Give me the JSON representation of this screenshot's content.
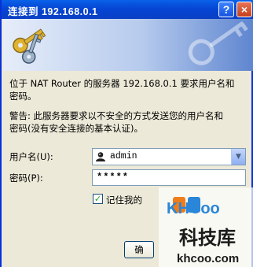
{
  "window": {
    "title": "连接到 192.168.0.1",
    "help_label": "?",
    "close_label": "×"
  },
  "message": {
    "line1": "位于 NAT Router 的服务器 192.168.0.1 要求用户名和",
    "line2": "密码。",
    "warning1": "警告: 此服务器要求以不安全的方式发送您的用户名和",
    "warning2": "密码(没有安全连接的基本认证)。"
  },
  "form": {
    "username_label": "用户名(U):",
    "username_value": "admin",
    "password_label": "密码(P):",
    "password_value": "*****",
    "remember_label": "记住我的",
    "remember_checked": "✓"
  },
  "buttons": {
    "ok_label": "确"
  },
  "watermark": {
    "logo_text": "KHCoo",
    "cn_text": "科技库",
    "url_text": "khcoo.com"
  },
  "colors": {
    "title_bar": "#0546d4",
    "dialog_bg": "#ece9d8",
    "watermark_blue": "#2a86d9",
    "watermark_orange": "#ef7d1a"
  }
}
